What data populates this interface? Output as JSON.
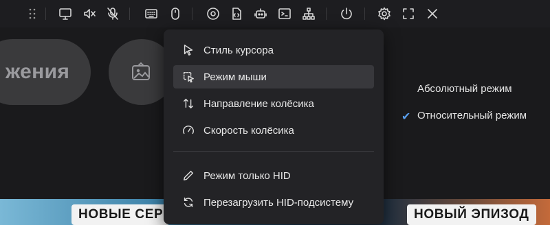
{
  "toolbar": {
    "icons": [
      "drag-handle-icon",
      "monitor-icon",
      "speaker-muted-icon",
      "mic-off-icon",
      "keyboard-icon",
      "mouse-icon",
      "record-icon",
      "script-icon",
      "bot-icon",
      "terminal-icon",
      "network-icon",
      "power-icon",
      "gear-icon",
      "fullscreen-icon",
      "close-icon"
    ]
  },
  "background": {
    "pill_text": "жения",
    "banner_left": "НОВЫЕ СЕР",
    "banner_right": "НОВЫЙ ЭПИЗОД"
  },
  "menu": {
    "items": [
      {
        "label": "Стиль курсора",
        "icon": "cursor-icon"
      },
      {
        "label": "Режим мыши",
        "icon": "mouse-mode-icon",
        "active": true
      },
      {
        "label": "Направление колёсика",
        "icon": "scroll-direction-icon"
      },
      {
        "label": "Скорость колёсика",
        "icon": "speed-gauge-icon"
      },
      {
        "label": "Режим только HID",
        "icon": "pencil-icon"
      },
      {
        "label": "Перезагрузить HID-подсистему",
        "icon": "refresh-icon"
      }
    ]
  },
  "submenu": {
    "options": [
      {
        "label": "Абсолютный режим",
        "selected": false
      },
      {
        "label": "Относительный режим",
        "selected": true
      }
    ]
  },
  "colors": {
    "accent": "#5aa0f0",
    "menu_bg": "#232326",
    "active_bg": "#38383c"
  }
}
